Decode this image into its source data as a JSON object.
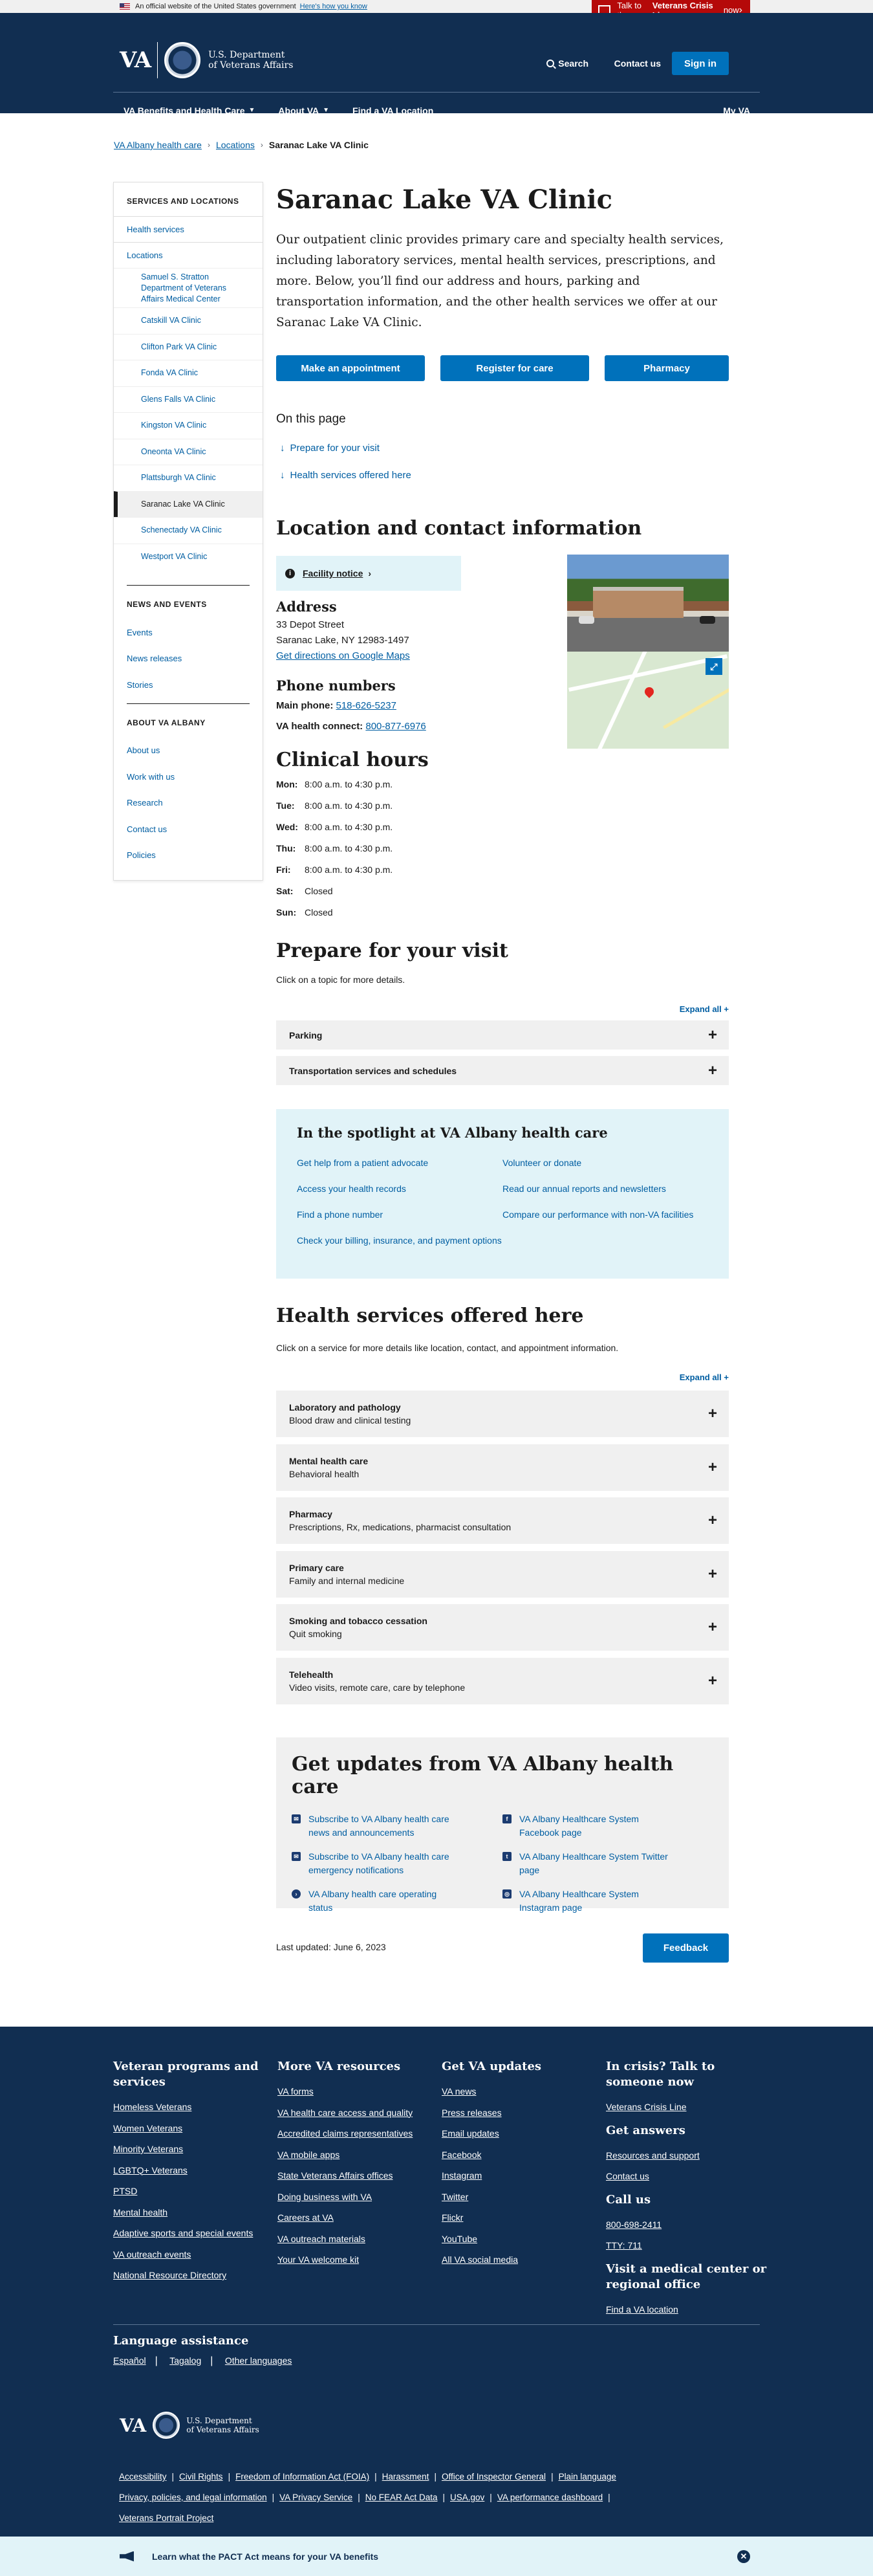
{
  "gov_banner": {
    "text": "An official website of the United States government",
    "how": "Here's how you know"
  },
  "crisis_line": {
    "prefix": "Talk to the ",
    "bold": "Veterans Crisis Line",
    "suffix": " now"
  },
  "header": {
    "logo_text": "VA",
    "dept_line1": "U.S. Department",
    "dept_line2": "of Veterans Affairs",
    "search": "Search",
    "contact": "Contact us",
    "signin": "Sign in",
    "nav": [
      "VA Benefits and Health Care",
      "About VA",
      "Find a VA Location"
    ],
    "myva": "My VA"
  },
  "breadcrumb": [
    "VA Albany health care",
    "Locations",
    "Saranac Lake VA Clinic"
  ],
  "sidebar": {
    "section1_title": "SERVICES AND LOCATIONS",
    "health_services": "Health services",
    "locations": "Locations",
    "location_items": [
      "Samuel S. Stratton Department of Veterans Affairs Medical Center",
      "Catskill VA Clinic",
      "Clifton Park VA Clinic",
      "Fonda VA Clinic",
      "Glens Falls VA Clinic",
      "Kingston VA Clinic",
      "Oneonta VA Clinic",
      "Plattsburgh VA Clinic",
      "Saranac Lake VA Clinic",
      "Schenectady VA Clinic",
      "Westport VA Clinic"
    ],
    "section2_title": "NEWS AND EVENTS",
    "news_items": [
      "Events",
      "News releases",
      "Stories"
    ],
    "section3_title": "ABOUT VA ALBANY",
    "about_items": [
      "About us",
      "Work with us",
      "Research",
      "Contact us",
      "Policies"
    ]
  },
  "page": {
    "title": "Saranac Lake VA Clinic",
    "intro": "Our outpatient clinic provides primary care and specialty health services, including laboratory services, mental health services, prescriptions, and more. Below, you’ll find our address and hours, parking and transportation information, and the other health services we offer at our Saranac Lake VA Clinic.",
    "buttons": [
      "Make an appointment",
      "Register for care",
      "Pharmacy"
    ],
    "on_this_page": "On this page",
    "jump_links": [
      "Prepare for your visit",
      "Health services offered here"
    ]
  },
  "location": {
    "heading": "Location and contact information",
    "notice": "Facility notice",
    "address_heading": "Address",
    "street": "33 Depot Street",
    "city": "Saranac Lake, NY 12983-1497",
    "directions": "Get directions on Google Maps",
    "phone_heading": "Phone numbers",
    "main_label": "Main phone:",
    "main_phone": "518-626-5237",
    "connect_label": "VA health connect:",
    "connect_phone": "800-877-6976"
  },
  "hours": {
    "heading": "Clinical hours",
    "rows": [
      {
        "day": "Mon:",
        "time": "8:00 a.m. to 4:30 p.m."
      },
      {
        "day": "Tue:",
        "time": "8:00 a.m. to 4:30 p.m."
      },
      {
        "day": "Wed:",
        "time": "8:00 a.m. to 4:30 p.m."
      },
      {
        "day": "Thu:",
        "time": "8:00 a.m. to 4:30 p.m."
      },
      {
        "day": "Fri:",
        "time": "8:00 a.m. to 4:30 p.m."
      },
      {
        "day": "Sat:",
        "time": "Closed"
      },
      {
        "day": "Sun:",
        "time": "Closed"
      }
    ]
  },
  "prepare": {
    "heading": "Prepare for your visit",
    "helper": "Click on a topic for more details.",
    "expand_all": "Expand all +",
    "items": [
      "Parking",
      "Transportation services and schedules"
    ]
  },
  "spotlight": {
    "heading": "In the spotlight at VA Albany health care",
    "left": [
      "Get help from a patient advocate",
      "Access your health records",
      "Find a phone number",
      "Check your billing, insurance, and payment options"
    ],
    "right": [
      "Volunteer or donate",
      "Read our annual reports and newsletters",
      "Compare our performance with non-VA facilities"
    ]
  },
  "services": {
    "heading": "Health services offered here",
    "helper": "Click on a service for more details like location, contact, and appointment information.",
    "expand_all": "Expand all +",
    "items": [
      {
        "title": "Laboratory and pathology",
        "sub": "Blood draw and clinical testing"
      },
      {
        "title": "Mental health care",
        "sub": "Behavioral health"
      },
      {
        "title": "Pharmacy",
        "sub": "Prescriptions, Rx, medications, pharmacist consultation"
      },
      {
        "title": "Primary care",
        "sub": "Family and internal medicine"
      },
      {
        "title": "Smoking and tobacco cessation",
        "sub": "Quit smoking"
      },
      {
        "title": "Telehealth",
        "sub": "Video visits, remote care, care by telephone"
      }
    ]
  },
  "updates": {
    "heading": "Get updates from VA Albany health care",
    "left": [
      "Subscribe to VA Albany health care news and announcements",
      "Subscribe to VA Albany health care emergency notifications",
      "VA Albany health care operating status"
    ],
    "right": [
      "VA Albany Healthcare System Facebook page",
      "VA Albany Healthcare System Twitter page",
      "VA Albany Healthcare System Instagram page"
    ]
  },
  "last_updated": "Last updated: June 6, 2023",
  "feedback": "Feedback",
  "footer": {
    "col1_heading": "Veteran programs and services",
    "col1": [
      "Homeless Veterans",
      "Women Veterans",
      "Minority Veterans",
      "LGBTQ+ Veterans",
      "PTSD",
      "Mental health",
      "Adaptive sports and special events",
      "VA outreach events",
      "National Resource Directory"
    ],
    "col2_heading": "More VA resources",
    "col2": [
      "VA forms",
      "VA health care access and quality",
      "Accredited claims representatives",
      "VA mobile apps",
      "State Veterans Affairs offices",
      "Doing business with VA",
      "Careers at VA",
      "VA outreach materials",
      "Your VA welcome kit"
    ],
    "col3_heading": "Get VA updates",
    "col3": [
      "VA news",
      "Press releases",
      "Email updates",
      "Facebook",
      "Instagram",
      "Twitter",
      "Flickr",
      "YouTube",
      "All VA social media"
    ],
    "col4_heading": "In crisis? Talk to someone now",
    "col4_crisis": "Veterans Crisis Line",
    "col4_answers_heading": "Get answers",
    "col4_answers": [
      "Resources and support",
      "Contact us"
    ],
    "col4_call_heading": "Call us",
    "col4_call": [
      "800-698-2411",
      "TTY: 711"
    ],
    "col4_visit_heading": "Visit a medical center or regional office",
    "col4_visit": "Find a VA location",
    "lang_heading": "Language assistance",
    "languages": [
      "Español",
      "Tagalog",
      "Other languages"
    ],
    "bottom_links": [
      "Accessibility",
      "Civil Rights",
      "Freedom of Information Act (FOIA)",
      "Harassment",
      "Office of Inspector General",
      "Plain language",
      "Privacy, policies, and legal information",
      "VA Privacy Service",
      "No FEAR Act Data",
      "USA.gov",
      "VA performance dashboard",
      "Veterans Portrait Project"
    ]
  },
  "pact_banner": "Learn what the PACT Act means for your VA benefits",
  "colors": {
    "navy": "#112e51",
    "primary": "#0071bb",
    "link": "#005ea2",
    "crisis": "#b50909",
    "light_blue": "#e1f3f8",
    "gray": "#f0f0f0"
  }
}
